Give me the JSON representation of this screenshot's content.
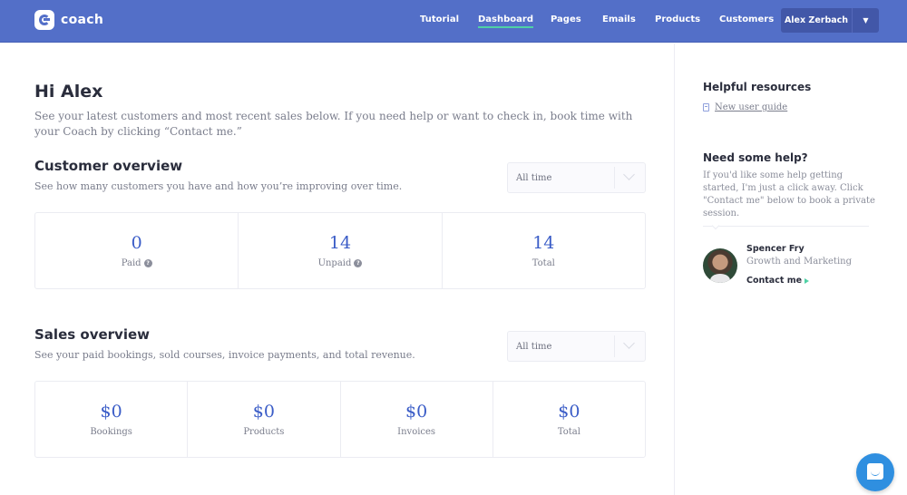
{
  "app": {
    "brand": "coach",
    "colors": {
      "nav_bg": "#536fc8",
      "accent": "#3a5cc7",
      "active_underline": "#4fd1a5",
      "chat": "#2f8fe0"
    }
  },
  "nav": {
    "items": [
      {
        "label": "Tutorial",
        "active": false
      },
      {
        "label": "Dashboard",
        "active": true
      },
      {
        "label": "Pages",
        "active": false
      },
      {
        "label": "Emails",
        "active": false
      },
      {
        "label": "Products",
        "active": false
      },
      {
        "label": "Customers",
        "active": false
      }
    ],
    "user": {
      "name": "Alex Zerbach",
      "caret": "▼"
    }
  },
  "main": {
    "greeting": "Hi Alex",
    "intro": "See your latest customers and most recent sales below. If you need help or want to check in, book time with your Coach by clicking “Contact me.”",
    "customer_overview": {
      "title": "Customer overview",
      "subtitle": "See how many customers you have and how you’re improving over time.",
      "filter": "All time",
      "stats": [
        {
          "value": "0",
          "label": "Paid",
          "help": true
        },
        {
          "value": "14",
          "label": "Unpaid",
          "help": true
        },
        {
          "value": "14",
          "label": "Total",
          "help": false
        }
      ]
    },
    "sales_overview": {
      "title": "Sales overview",
      "subtitle": "See your paid bookings, sold courses, invoice payments, and total revenue.",
      "filter": "All time",
      "stats": [
        {
          "value": "$0",
          "label": "Bookings"
        },
        {
          "value": "$0",
          "label": "Products"
        },
        {
          "value": "$0",
          "label": "Invoices"
        },
        {
          "value": "$0",
          "label": "Total"
        }
      ]
    }
  },
  "sidebar": {
    "resources_title": "Helpful resources",
    "guide_link": "New user guide",
    "help_title": "Need some help?",
    "help_text": "If you'd like some help getting started, I'm just a click away. Click \"Contact me\" below to book a private session.",
    "coach": {
      "name": "Spencer Fry",
      "role": "Growth and Marketing",
      "contact_label": "Contact me"
    }
  },
  "icons": {
    "help": "?",
    "chat": "chat-bubble-icon"
  }
}
